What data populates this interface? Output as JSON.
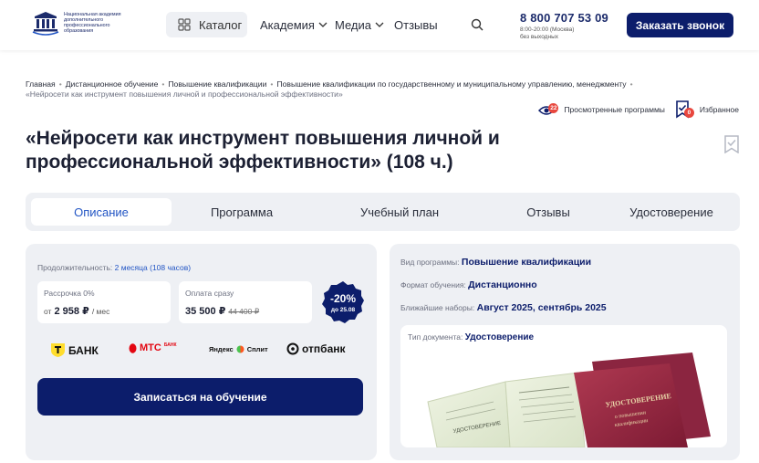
{
  "header": {
    "logo_text": [
      "Национальная академия",
      "дополнительного",
      "профессионального",
      "образования"
    ],
    "catalog_label": "Каталог",
    "nav": [
      {
        "label": "Академия",
        "dropdown": true
      },
      {
        "label": "Медиа",
        "dropdown": true
      },
      {
        "label": "Отзывы",
        "dropdown": false
      }
    ],
    "phone": "8 800 707 53 09",
    "hours": "8:00-20:00 (Москва)",
    "days": "без выходных",
    "call_button": "Заказать звонок"
  },
  "breadcrumb": {
    "items": [
      "Главная",
      "Дистанционное обучение",
      "Повышение квалификации",
      "Повышение квалификации по государственному и муниципальному управлению, менеджменту"
    ],
    "current": "«Нейросети как инструмент повышения личной и профессиональной эффективности»"
  },
  "toplinks": {
    "viewed_label": "Просмотренные программы",
    "viewed_count": "22",
    "favorites_label": "Избранное",
    "favorites_count": "0"
  },
  "title": "«Нейросети как инструмент повышения личной и профессиональной эффективности» (108 ч.)",
  "tabs": [
    "Описание",
    "Программа",
    "Учебный план",
    "Отзывы",
    "Удостоверение"
  ],
  "pricing": {
    "duration_label": "Продолжительность:",
    "duration_value": "2 месяца (108 часов)",
    "installment_label": "Рассрочка 0%",
    "installment_prefix": "от",
    "installment_value": "2 958 ₽",
    "installment_unit": "/ мес",
    "full_label": "Оплата сразу",
    "full_value": "35 500 ₽",
    "full_old": "44 400 ₽",
    "discount": "-20%",
    "discount_until": "до 25.08",
    "banks": [
      "БАНК",
      "МТС",
      "БАНК",
      "Яндекс",
      "Сплит",
      "отпбанк"
    ],
    "enroll_button": "Записаться на обучение"
  },
  "program": {
    "type_label": "Вид программы:",
    "type_value": "Повышение квалификации",
    "format_label": "Формат обучения:",
    "format_value": "Дистанционно",
    "intake_label": "Ближайшие наборы:",
    "intake_value": "Август 2025, сентябрь 2025",
    "doc_label": "Тип документа:",
    "doc_value": "Удостоверение",
    "doc_cover_text": [
      "УДОСТОВЕРЕНИЕ",
      "о повышении",
      "квалификации"
    ],
    "doc_inner_text": "УДОСТОВЕРЕНИЕ"
  },
  "colors": {
    "brand": "#0c1d6b",
    "link": "#2255c4",
    "panel": "#eef0f4",
    "badge": "#e8473e"
  }
}
